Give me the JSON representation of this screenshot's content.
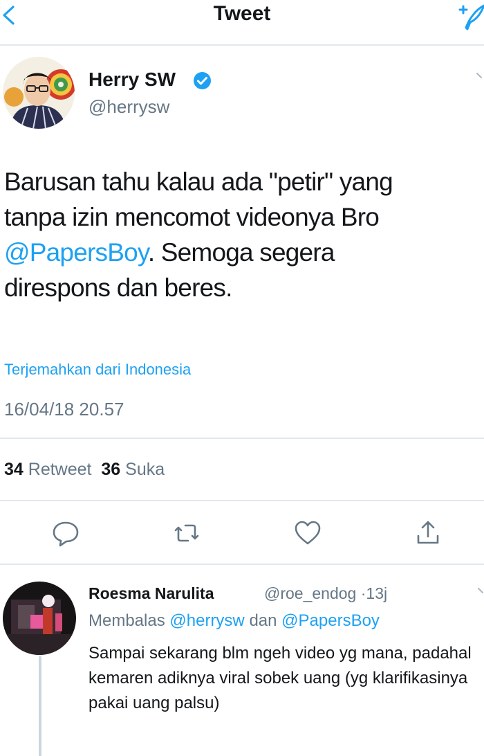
{
  "header": {
    "title": "Tweet"
  },
  "tweet": {
    "author_name": "Herry SW",
    "author_handle": "@herrysw",
    "text_line1": "Barusan tahu kalau ada \"petir\" yang",
    "text_line2": "tanpa izin mencomot videonya Bro",
    "text_mention": "@PapersBoy",
    "text_line3_rest": ". Semoga segera",
    "text_line4": "direspons dan beres.",
    "translate_label": "Terjemahkan dari Indonesia",
    "timestamp": "16/04/18 20.57",
    "retweet_count": "34",
    "retweet_label": "Retweet",
    "like_count": "36",
    "like_label": "Suka"
  },
  "reply": {
    "author_name": "Roesma Narulita",
    "author_handle": "@roe_endog",
    "separator": "·",
    "time": "13j",
    "replying_label": "Membalas",
    "replying_to_1": "@herrysw",
    "replying_and": "dan",
    "replying_to_2": "@PapersBoy",
    "text": "Sampai sekarang blm ngeh video yg mana, padahal kemaren adiknya viral sobek uang (yg klarifikasinya pakai uang palsu)"
  },
  "colors": {
    "accent": "#1da1f2",
    "secondary_text": "#657786",
    "divider": "#e1e8ed"
  },
  "icons": [
    "back-icon",
    "compose-tweet-icon",
    "verified-badge-icon",
    "chevron-down-icon",
    "reply-icon",
    "retweet-icon",
    "like-icon",
    "share-icon"
  ]
}
